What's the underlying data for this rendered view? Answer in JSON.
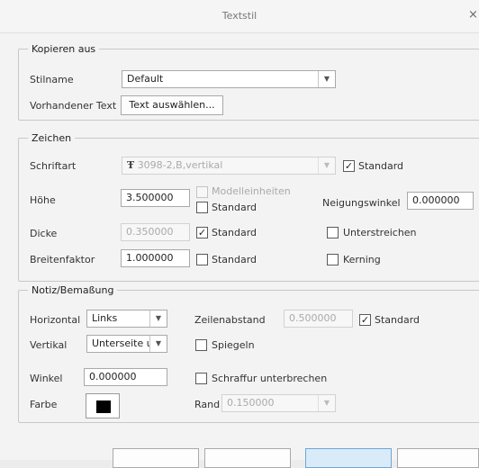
{
  "window": {
    "title": "Textstil",
    "close": "×"
  },
  "kopieren": {
    "legend": "Kopieren aus",
    "stilname_label": "Stilname",
    "stilname_value": "Default",
    "vorhandener_label": "Vorhandener Text",
    "select_button": "Text auswählen..."
  },
  "zeichen": {
    "legend": "Zeichen",
    "schriftart_label": "Schriftart",
    "font_icon": "Ŧ",
    "schriftart_value": "3098-2,B,vertikal",
    "schriftart_std": "Standard",
    "hoehe_label": "Höhe",
    "hoehe_value": "3.500000",
    "modelleinheiten": "Modelleinheiten",
    "hoehe_std": "Standard",
    "neigung_label": "Neigungswinkel",
    "neigung_value": "0.000000",
    "dicke_label": "Dicke",
    "dicke_value": "0.350000",
    "dicke_std": "Standard",
    "unterstreichen": "Unterstreichen",
    "breite_label": "Breitenfaktor",
    "breite_value": "1.000000",
    "breite_std": "Standard",
    "kerning": "Kerning"
  },
  "notiz": {
    "legend": "Notiz/Bemaßung",
    "horizontal_label": "Horizontal",
    "horizontal_value": "Links",
    "zeilen_label": "Zeilenabstand",
    "zeilen_value": "0.500000",
    "zeilen_std": "Standard",
    "vertikal_label": "Vertikal",
    "vertikal_value": "Unterseite ι",
    "spiegeln": "Spiegeln",
    "winkel_label": "Winkel",
    "winkel_value": "0.000000",
    "schraffur": "Schraffur unterbrechen",
    "farbe_label": "Farbe",
    "farbe_color": "#000000",
    "rand_label": "Rand",
    "rand_value": "0.150000"
  },
  "icons": {
    "dropdown": "▼",
    "check": "✓"
  }
}
